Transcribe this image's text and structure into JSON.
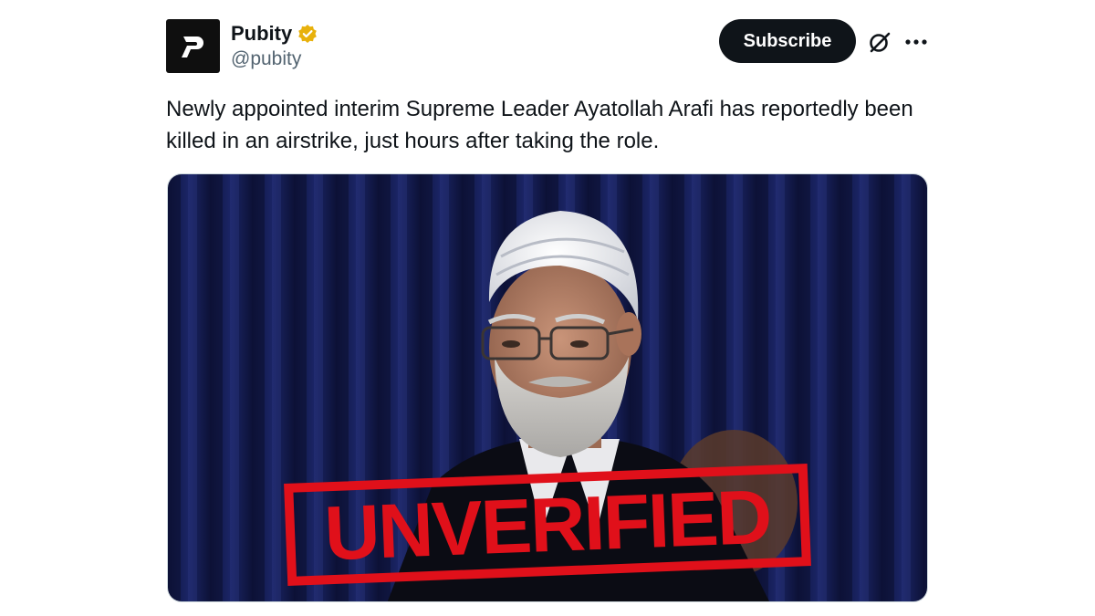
{
  "author": {
    "display_name": "Pubity",
    "handle": "@pubity",
    "verified": true,
    "verified_color": "#e8b10c",
    "avatar_letter": "P",
    "avatar_icon": "pubity-logo-icon"
  },
  "actions": {
    "subscribe_label": "Subscribe",
    "grok_icon": "grok-icon",
    "more_icon": "more-options-icon"
  },
  "tweet": {
    "text": "Newly appointed interim Supreme Leader Ayatollah Arafi has reportedly been killed in an airstrike, just hours after taking the role."
  },
  "media": {
    "stamp_text": "UNVERIFIED",
    "stamp_color": "#e0101a"
  }
}
